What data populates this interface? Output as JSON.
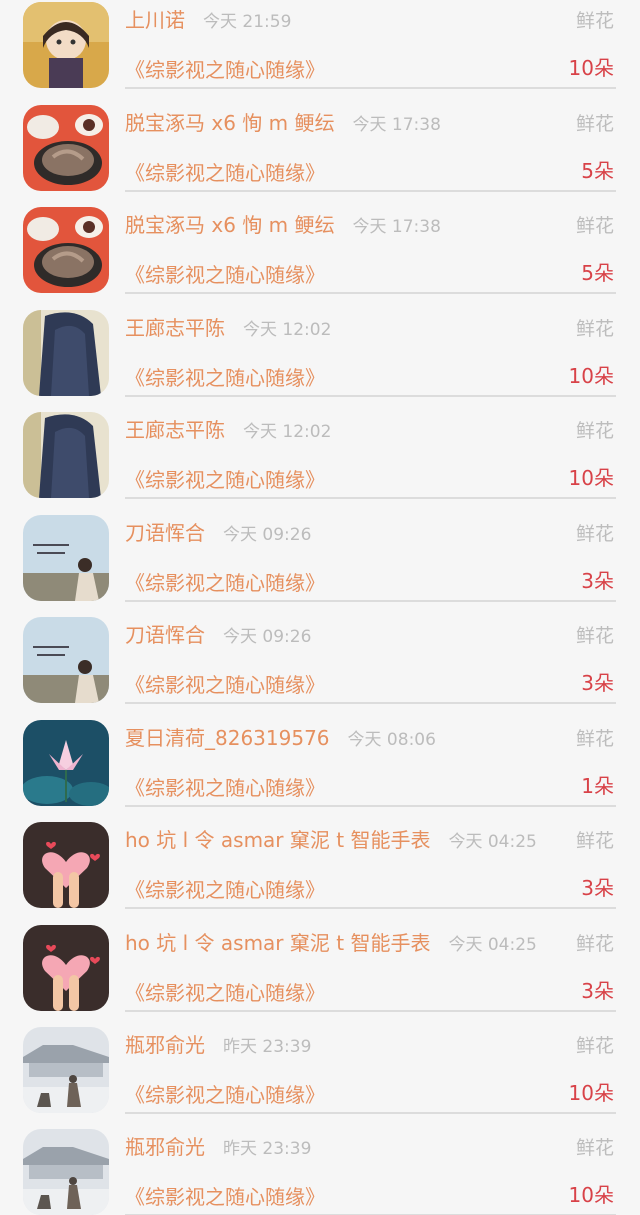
{
  "rows": [
    {
      "name": "上川诺",
      "time": "今天 21:59",
      "gift": "鲜花",
      "book": "《综影视之随心随缘》",
      "count": "10朵",
      "avatar": "anime-character-avatar"
    },
    {
      "name": "脱宝涿马 x6 恂 m 鲠纭",
      "time": "今天 17:38",
      "gift": "鲜花",
      "book": "《综影视之随心随缘》",
      "count": "5朵",
      "avatar": "food-plate-avatar"
    },
    {
      "name": "脱宝涿马 x6 恂 m 鲠纭",
      "time": "今天 17:38",
      "gift": "鲜花",
      "book": "《综影视之随心随缘》",
      "count": "5朵",
      "avatar": "food-plate-avatar"
    },
    {
      "name": "王廊志平陈",
      "time": "今天 12:02",
      "gift": "鲜花",
      "book": "《综影视之随心随缘》",
      "count": "10朵",
      "avatar": "long-hair-avatar"
    },
    {
      "name": "王廊志平陈",
      "time": "今天 12:02",
      "gift": "鲜花",
      "book": "《综影视之随心随缘》",
      "count": "10朵",
      "avatar": "long-hair-avatar"
    },
    {
      "name": "刀语恽合",
      "time": "今天 09:26",
      "gift": "鲜花",
      "book": "《综影视之随心随缘》",
      "count": "3朵",
      "avatar": "sky-girl-avatar"
    },
    {
      "name": "刀语恽合",
      "time": "今天 09:26",
      "gift": "鲜花",
      "book": "《综影视之随心随缘》",
      "count": "3朵",
      "avatar": "sky-girl-avatar"
    },
    {
      "name": "夏日清荷_826319576",
      "time": "今天 08:06",
      "gift": "鲜花",
      "book": "《综影视之随心随缘》",
      "count": "1朵",
      "avatar": "lotus-avatar"
    },
    {
      "name": "ho 坑 l 令 asmar 窠泥 t 智能手表",
      "time": "今天 04:25",
      "gift": "鲜花",
      "book": "《综影视之随心随缘》",
      "count": "3朵",
      "avatar": "hearts-avatar"
    },
    {
      "name": "ho 坑 l 令 asmar 窠泥 t 智能手表",
      "time": "今天 04:25",
      "gift": "鲜花",
      "book": "《综影视之随心随缘》",
      "count": "3朵",
      "avatar": "hearts-avatar"
    },
    {
      "name": "瓶邪俞光",
      "time": "昨天 23:39",
      "gift": "鲜花",
      "book": "《综影视之随心随缘》",
      "count": "10朵",
      "avatar": "snow-palace-avatar"
    },
    {
      "name": "瓶邪俞光",
      "time": "昨天 23:39",
      "gift": "鲜花",
      "book": "《综影视之随心随缘》",
      "count": "10朵",
      "avatar": "snow-palace-avatar"
    }
  ]
}
